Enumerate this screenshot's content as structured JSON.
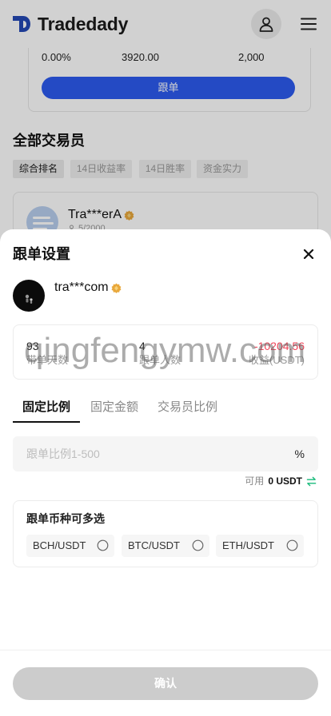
{
  "header": {
    "brand": "Tradedady",
    "icons": [
      "tradedady-logo-icon",
      "user-icon",
      "menu-icon"
    ]
  },
  "background": {
    "summary_card": {
      "values": [
        "0.00%",
        "3920.00",
        "2,000"
      ],
      "follow_button": "跟单"
    },
    "section_title": "全部交易员",
    "filters": [
      {
        "label": "综合排名",
        "selected": true
      },
      {
        "label": "14日收益率",
        "selected": false
      },
      {
        "label": "14日胜率",
        "selected": false
      },
      {
        "label": "资金实力",
        "selected": false
      }
    ],
    "trader_card": {
      "name": "Tra***erA",
      "followers": "5/2000",
      "icons": [
        "avatar",
        "verified-badge-icon",
        "followers-icon"
      ]
    }
  },
  "sheet": {
    "title": "跟单设置",
    "trader_name": "tra***com",
    "stats": [
      {
        "value": "93",
        "label": "带单天数",
        "negative": false
      },
      {
        "value": "4",
        "label": "跟单人数",
        "negative": false
      },
      {
        "value": "-10204.56",
        "label": "收益(USDT)",
        "negative": true
      }
    ],
    "tabs": [
      {
        "label": "固定比例",
        "active": true
      },
      {
        "label": "固定金额",
        "active": false
      },
      {
        "label": "交易员比例",
        "active": false
      }
    ],
    "ratio_input": {
      "value": "",
      "placeholder": "跟单比例1-500",
      "unit": "%"
    },
    "available": {
      "label": "可用",
      "amount": "0 USDT"
    },
    "coins": {
      "title": "跟单币种可多选",
      "options": [
        {
          "label": "BCH/USDT",
          "checked": false
        },
        {
          "label": "BTC/USDT",
          "checked": false
        },
        {
          "label": "ETH/USDT",
          "checked": false
        }
      ]
    },
    "confirm_label": "确认",
    "icons": [
      "close-icon",
      "verified-badge-icon",
      "swap-icon",
      "radio-icon"
    ]
  },
  "watermark": "qingfengymw.com",
  "colors": {
    "accent": "#2d5bf0",
    "negative": "#f0465a",
    "positive": "#16b979",
    "badge_gold": "#e9a83b",
    "brand_blue": "#2448b5",
    "disabled": "#cccccc"
  }
}
